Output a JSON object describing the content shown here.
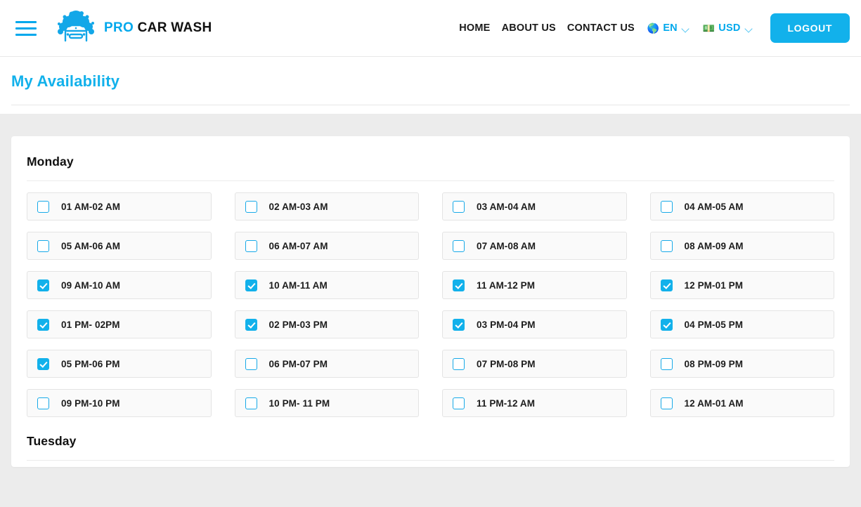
{
  "header": {
    "menu_icon": "hamburger-menu-icon",
    "logo_icon": "car-wash-logo-icon",
    "brand_pro": "PRO",
    "brand_rest": " CAR WASH",
    "nav_links": [
      {
        "label": "HOME"
      },
      {
        "label": "ABOUT US"
      },
      {
        "label": "CONTACT US"
      }
    ],
    "language": {
      "flag": "🌎",
      "code": "EN",
      "chevron": "chevron-down-icon"
    },
    "currency": {
      "flag": "💵",
      "code": "USD",
      "chevron": "chevron-down-icon"
    },
    "logout_label": "LOGOUT"
  },
  "page": {
    "title": "My Availability"
  },
  "colors": {
    "accent": "#12b1eb",
    "accent_alt": "#00a8ec",
    "page_bg": "#ececec",
    "card_bg": "#ffffff",
    "slot_bg": "#fafafa",
    "text_dark": "#1a1a1a"
  },
  "availability": {
    "days": [
      {
        "name": "Monday",
        "slots": [
          {
            "label": "01 AM-02 AM",
            "checked": false
          },
          {
            "label": "02 AM-03 AM",
            "checked": false
          },
          {
            "label": "03 AM-04 AM",
            "checked": false
          },
          {
            "label": "04 AM-05 AM",
            "checked": false
          },
          {
            "label": "05 AM-06 AM",
            "checked": false
          },
          {
            "label": "06 AM-07 AM",
            "checked": false
          },
          {
            "label": "07 AM-08 AM",
            "checked": false
          },
          {
            "label": "08 AM-09 AM",
            "checked": false
          },
          {
            "label": "09 AM-10 AM",
            "checked": true
          },
          {
            "label": "10 AM-11 AM",
            "checked": true
          },
          {
            "label": "11 AM-12 PM",
            "checked": true
          },
          {
            "label": "12 PM-01 PM",
            "checked": true
          },
          {
            "label": "01 PM- 02PM",
            "checked": true
          },
          {
            "label": "02 PM-03 PM",
            "checked": true
          },
          {
            "label": "03 PM-04 PM",
            "checked": true
          },
          {
            "label": "04 PM-05 PM",
            "checked": true
          },
          {
            "label": "05 PM-06 PM",
            "checked": true
          },
          {
            "label": "06 PM-07 PM",
            "checked": false
          },
          {
            "label": "07 PM-08 PM",
            "checked": false
          },
          {
            "label": "08 PM-09 PM",
            "checked": false
          },
          {
            "label": "09 PM-10 PM",
            "checked": false
          },
          {
            "label": "10 PM- 11 PM",
            "checked": false
          },
          {
            "label": "11 PM-12 AM",
            "checked": false
          },
          {
            "label": "12 AM-01 AM",
            "checked": false
          }
        ]
      },
      {
        "name": "Tuesday",
        "slots": []
      }
    ]
  }
}
